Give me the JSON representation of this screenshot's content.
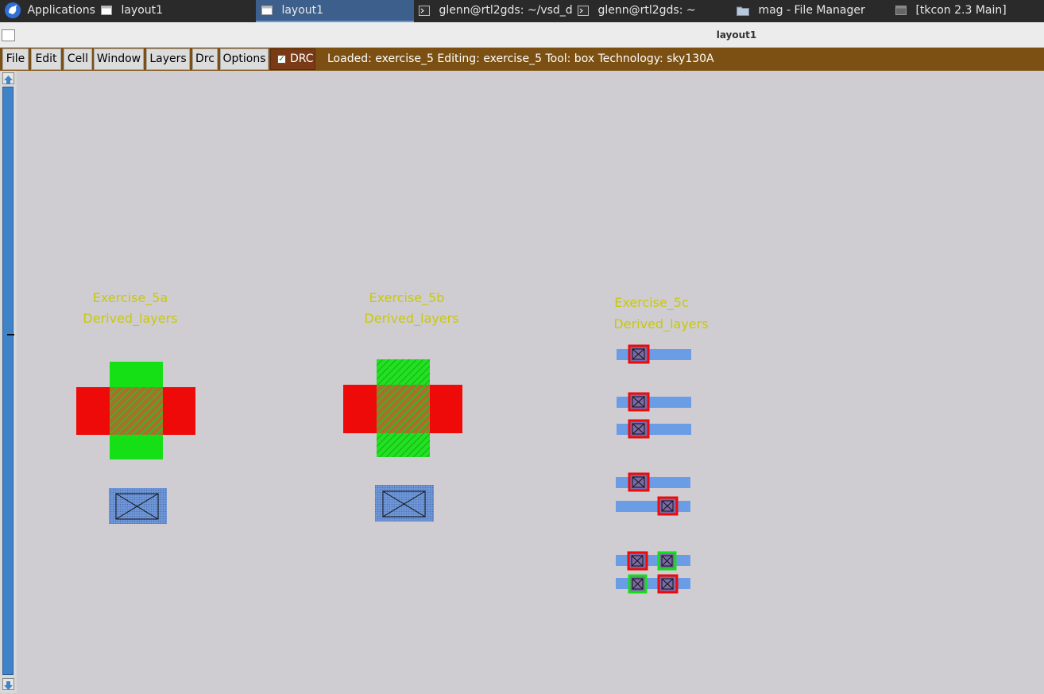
{
  "taskbar": {
    "app_menu": "Applications",
    "items": [
      {
        "label": "layout1",
        "active": false
      },
      {
        "label": "layout1",
        "active": true
      },
      {
        "label": "glenn@rtl2gds: ~/vsd_d...",
        "active": false
      },
      {
        "label": "glenn@rtl2gds: ~",
        "active": false
      },
      {
        "label": "mag - File Manager",
        "active": false
      },
      {
        "label": "[tkcon 2.3 Main]",
        "active": false
      }
    ]
  },
  "window": {
    "title": "layout1"
  },
  "menu": {
    "items": [
      "File",
      "Edit",
      "Cell",
      "Window",
      "Layers",
      "Drc",
      "Options"
    ],
    "drc_toggle": {
      "label": "DRC",
      "checked": true
    }
  },
  "status": "Loaded: exercise_5 Editing: exercise_5 Tool: box  Technology: sky130A",
  "layout": {
    "labels": {
      "a_name": "Exercise_5a",
      "a_sub": "Derived_layers",
      "b_name": "Exercise_5b",
      "b_sub": "Derived_layers",
      "c_name": "Exercise_5c",
      "c_sub": "Derived_layers"
    }
  },
  "colors": {
    "canvas_bg": "#cfcdd1",
    "poly": "#ef0a0a",
    "diff": "#15df15",
    "metal": "#6b9de6",
    "label": "#c8c80e",
    "menubar": "#7b5012",
    "drc_button": "#7a3a16",
    "scroll_track": "#3f84c8"
  }
}
